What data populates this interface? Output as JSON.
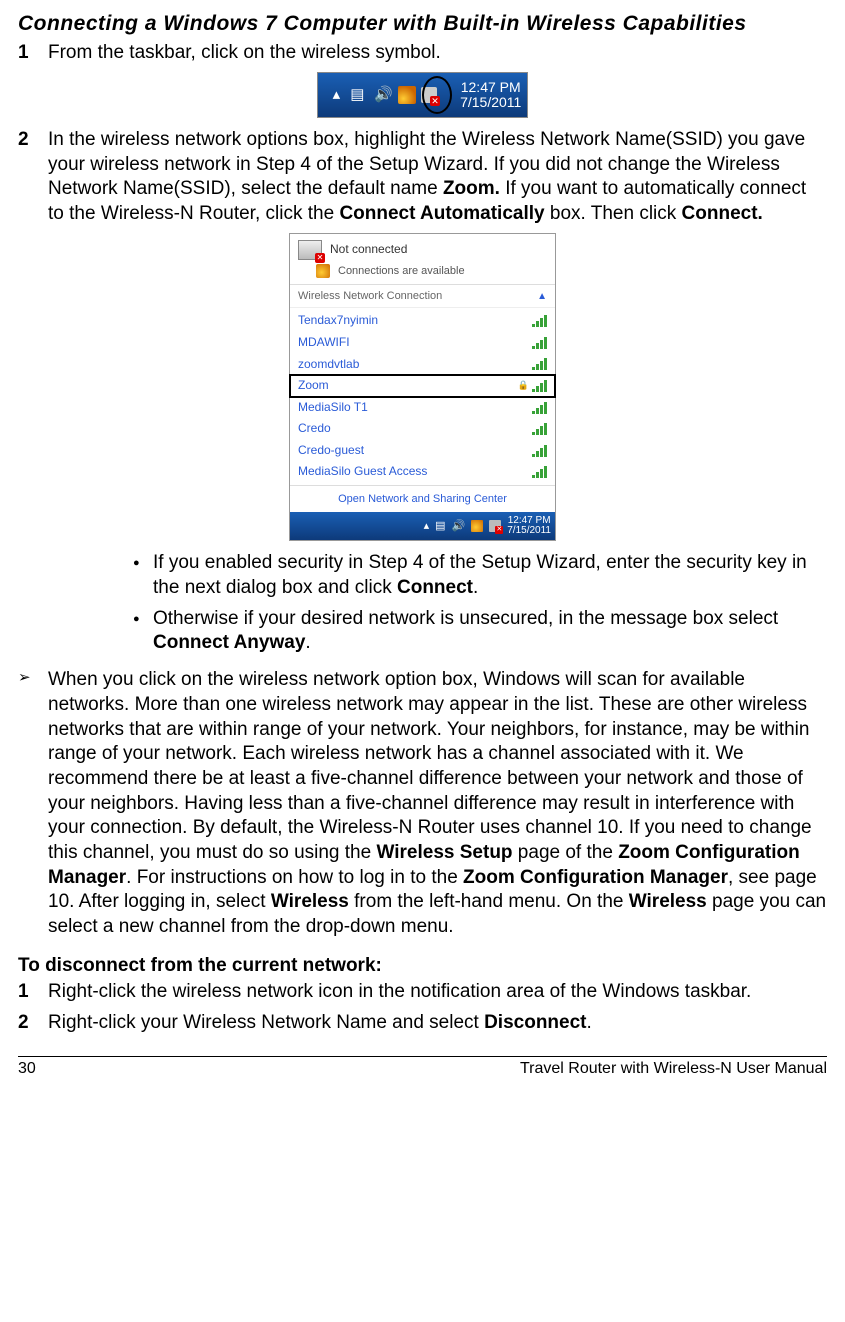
{
  "heading": "Connecting a Windows 7 Computer with Built-in Wireless Capabilities",
  "step1": {
    "num": "1",
    "text": "From the taskbar, click on the wireless symbol."
  },
  "taskbar_fig": {
    "time": "12:47 PM",
    "date": "7/15/2011"
  },
  "step2": {
    "num": "2",
    "p1a": "In the wireless network options box, highlight the Wireless Network Name(SSID) you gave your wireless network in Step 4 of the Setup Wizard. If you did not change the Wireless Network Name(SSID), select the default name ",
    "p1b_bold": "Zoom.",
    "p1c": " If you want to automatically connect to the Wireless-N Router, click the ",
    "p1d_bold": "Connect Automatically",
    "p1e": " box. Then click ",
    "p1f_bold": "Connect."
  },
  "wifi_popup": {
    "not_connected": "Not connected",
    "available": "Connections are available",
    "section_hdr": "Wireless Network Connection",
    "items": [
      {
        "name": "Tendax7nyimin",
        "boxed": false
      },
      {
        "name": "MDAWIFI",
        "boxed": false
      },
      {
        "name": "zoomdvtlab",
        "boxed": false
      },
      {
        "name": "Zoom",
        "boxed": true,
        "locked": true
      },
      {
        "name": "MediaSilo T1",
        "boxed": false
      },
      {
        "name": "Credo",
        "boxed": false
      },
      {
        "name": "Credo-guest",
        "boxed": false
      },
      {
        "name": "MediaSilo Guest Access",
        "boxed": false
      }
    ],
    "open_center": "Open Network and Sharing Center",
    "tb_time": "12:47 PM",
    "tb_date": "7/15/2011"
  },
  "bullets": {
    "b1a": "If you enabled security in Step 4 of the Setup Wizard, enter the security key in the next dialog box and click ",
    "b1b_bold": "Connect",
    "b1c": ".",
    "b2a": "Otherwise if your desired network is unsecured, in the message box select ",
    "b2b_bold": "Connect Anyway",
    "b2c": "."
  },
  "info_para": {
    "t1": "When you click on the wireless network option box, Windows will scan for available networks. More than one wireless network may appear in the list. These are other wireless networks that are within range of your network. Your neighbors, for instance, may be within range of your network. Each wireless network has a channel associated with it. We recommend there be at least a five-channel difference between your network and those of your neighbors. Having less than a five-channel difference may result in interference with your connection. By default, the Wireless-N Router uses channel 10. If you need to change this channel, you must do so using the ",
    "b1": "Wireless Setup",
    "t2": " page of the ",
    "b2": "Zoom Configuration Manager",
    "t3": ". For instructions on how to log in to the ",
    "b3": "Zoom Configuration Manager",
    "t4": ", see page 10. After logging in, select ",
    "b4": "Wireless",
    "t5": " from the left-hand menu. On the ",
    "b5": "Wireless",
    "t6": " page you can select a new channel from the drop-down menu."
  },
  "disconnect": {
    "heading": "To disconnect from the current network:",
    "s1_num": "1",
    "s1": "Right-click the wireless network icon in the notification area of the Windows taskbar.",
    "s2_num": "2",
    "s2a": "Right-click your Wireless Network Name and select ",
    "s2b_bold": "Disconnect",
    "s2c": "."
  },
  "footer": {
    "page": "30",
    "title": "Travel Router with Wireless-N User Manual"
  }
}
